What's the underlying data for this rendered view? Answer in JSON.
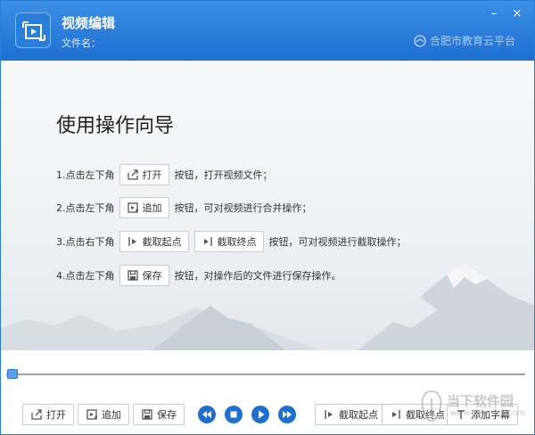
{
  "window": {
    "title": "视频编辑",
    "file_label": "文件名：",
    "brand": "合肥市教育云平台",
    "min_glyph": "–",
    "close_glyph": "×"
  },
  "guide": {
    "heading": "使用操作向导",
    "steps": [
      {
        "prefix": "1.点击左下角",
        "buttons": [
          {
            "icon": "open-icon",
            "label": "打开"
          }
        ],
        "suffix": "按钮，打开视频文件；"
      },
      {
        "prefix": "2.点击左下角",
        "buttons": [
          {
            "icon": "add-icon",
            "label": "追加"
          }
        ],
        "suffix": "按钮，可对视频进行合并操作；"
      },
      {
        "prefix": "3.点击右下角",
        "buttons": [
          {
            "icon": "cut-start-icon",
            "label": "截取起点"
          },
          {
            "icon": "cut-end-icon",
            "label": "截取终点"
          }
        ],
        "suffix": "按钮，可对视频进行截取操作；"
      },
      {
        "prefix": "4.点击左下角",
        "buttons": [
          {
            "icon": "save-icon",
            "label": "保存"
          }
        ],
        "suffix": "按钮，对操作后的文件进行保存操作。"
      }
    ]
  },
  "timeline": {
    "position": 0
  },
  "toolbar": {
    "open": "打开",
    "add": "追加",
    "save": "保存",
    "cut_start": "截取起点",
    "cut_end": "截取终点",
    "add_subtitle": "添加字幕",
    "playback": [
      "rewind-icon",
      "stop-icon",
      "play-icon",
      "fast-forward-icon"
    ]
  },
  "watermark": {
    "text": "当下软件园",
    "url": "www.downxia.com"
  },
  "colors": {
    "titlebar": "#1f6fd1",
    "accent": "#1f6fd1",
    "content_bg": "#eef1f4"
  }
}
